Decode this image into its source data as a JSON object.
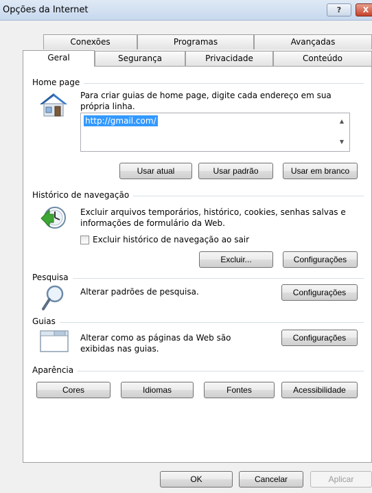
{
  "window": {
    "title": "Opções da Internet",
    "help_glyph": "?",
    "close_glyph": "X"
  },
  "tabs": {
    "row1": [
      "Conexões",
      "Programas",
      "Avançadas"
    ],
    "row2": [
      "Geral",
      "Segurança",
      "Privacidade",
      "Conteúdo"
    ],
    "active": "Geral"
  },
  "home_page": {
    "heading": "Home page",
    "instructions": "Para criar guias de home page, digite cada endereço em sua própria linha.",
    "url": "http://gmail.com/",
    "buttons": [
      "Usar atual",
      "Usar padrão",
      "Usar em branco"
    ]
  },
  "history": {
    "heading": "Histórico de navegação",
    "description": "Excluir arquivos temporários, histórico, cookies, senhas salvas e informações de formulário da Web.",
    "checkbox_label": "Excluir histórico de navegação ao sair",
    "checkbox_checked": false,
    "delete_label": "Excluir...",
    "settings_label": "Configurações"
  },
  "search": {
    "heading": "Pesquisa",
    "description": "Alterar padrões de pesquisa.",
    "settings_label": "Configurações"
  },
  "tabs_group": {
    "heading": "Guias",
    "description": "Alterar como as páginas da Web são exibidas nas guias.",
    "settings_label": "Configurações"
  },
  "appearance": {
    "heading": "Aparência",
    "buttons": [
      "Cores",
      "Idiomas",
      "Fontes",
      "Acessibilidade"
    ]
  },
  "footer": {
    "ok": "OK",
    "cancel": "Cancelar",
    "apply": "Aplicar"
  },
  "icons": {
    "home": "home-icon",
    "history": "history-clock-icon",
    "search": "magnifier-icon",
    "tabs": "tabs-window-icon"
  },
  "colors": {
    "selection": "#3399ff",
    "history_green": "#3fa535"
  }
}
